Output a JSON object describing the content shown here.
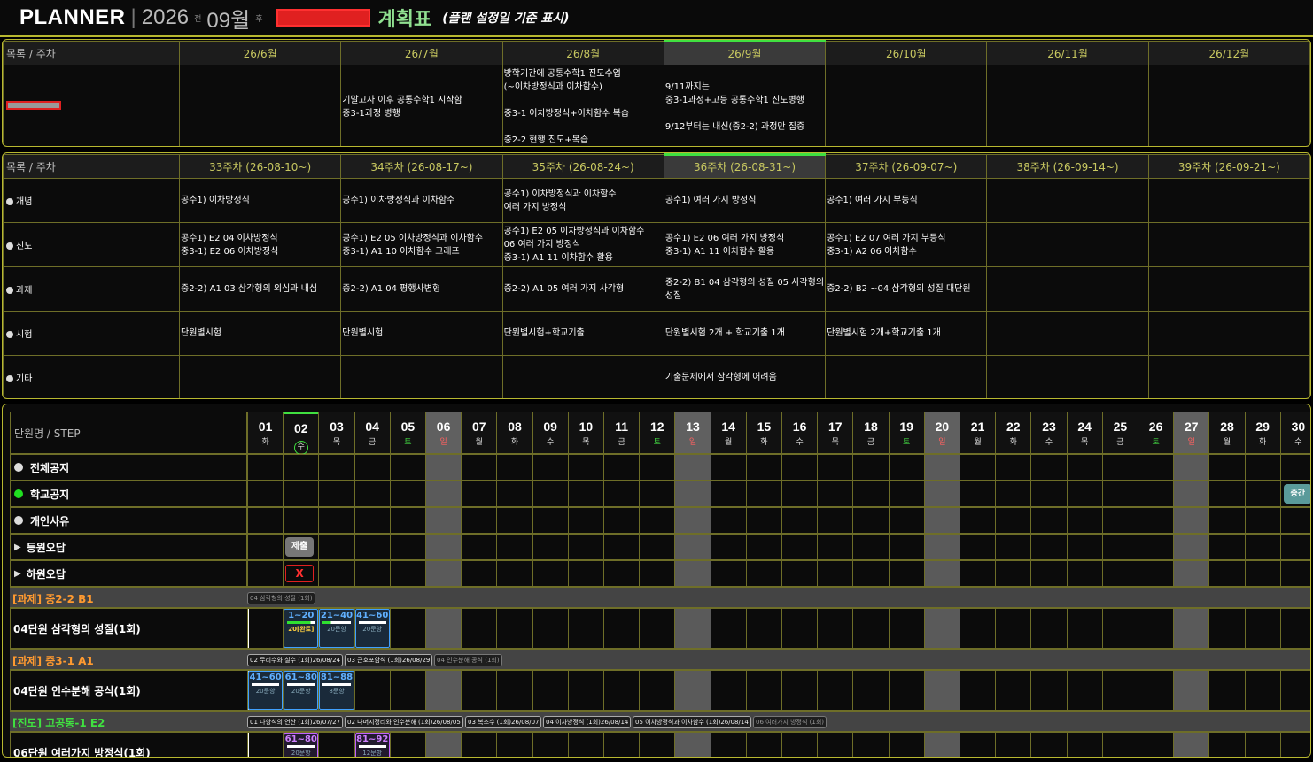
{
  "header": {
    "planner": "PLANNER",
    "sep": "|",
    "year": "2026",
    "prev_small": "전",
    "month": "09월",
    "next_small": "후",
    "title": "계획표",
    "note": "(플랜 설정일 기준 표시)"
  },
  "monthly": {
    "corner": "목록 / 주차",
    "columns": [
      "26/6월",
      "26/7월",
      "26/8월",
      "26/9월",
      "26/10월",
      "26/11월",
      "26/12월"
    ],
    "current_index": 3,
    "cells": [
      "",
      "기말고사 이후 공통수학1 시작함\n중3-1과정 병행",
      "방학기간에 공통수학1 진도수업\n(~이차방정식과 이차함수)\n\n중3-1 이차방정식+이차함수 복습\n\n중2-2 현행 진도+복습",
      "9/11까지는\n   중3-1과정+고등 공통수학1 진도병행\n\n9/12부터는 내신(중2-2) 과정만 집중",
      "",
      "",
      ""
    ]
  },
  "weekly": {
    "corner": "목록 / 주차",
    "columns": [
      "33주차 (26-08-10~)",
      "34주차 (26-08-17~)",
      "35주차 (26-08-24~)",
      "36주차 (26-08-31~)",
      "37주차 (26-09-07~)",
      "38주차 (26-09-14~)",
      "39주차 (26-09-21~)"
    ],
    "current_index": 3,
    "rows": [
      {
        "label": "개념",
        "cells": [
          "공수1) 이차방정식",
          "공수1) 이차방정식과 이차함수",
          "공수1) 이차방정식과 이차함수\n여러 가지 방정식",
          "공수1) 여러 가지 방정식",
          "공수1) 여러 가지 부등식",
          "",
          ""
        ]
      },
      {
        "label": "진도",
        "cells": [
          "공수1) E2 04 이차방정식\n중3-1) E2 06 이차방정식",
          "공수1) E2 05 이차방정식과 이차함수\n중3-1) A1 10 이차함수 그래프",
          "공수1) E2 05 이차방정식과 이차함수\n06 여러 가지 방정식\n중3-1) A1 11 이차함수 활용",
          "공수1) E2 06 여러 가지 방정식\n중3-1) A1 11 이차함수 활용",
          "공수1) E2 07 여러 가지 부등식\n중3-1) A2 06 이차함수",
          "",
          ""
        ]
      },
      {
        "label": "과제",
        "cells": [
          "중2-2) A1 03 삼각형의 외심과 내심",
          "중2-2) A1 04 평행사변형",
          "중2-2) A1 05 여러 가지 사각형",
          "중2-2) B1 04 삼각형의 성질 05 사각형의 성질",
          "중2-2) B2 ~04 삼각형의 성질 대단원",
          "",
          ""
        ]
      },
      {
        "label": "시험",
        "cells": [
          "단원별시험",
          "단원별시험",
          "단원별시험+학교기출",
          "단원별시험 2개 + 학교기출 1개",
          "단원별시험 2개+학교기출 1개",
          "",
          ""
        ]
      },
      {
        "label": "기타",
        "cells": [
          "",
          "",
          "",
          "기출문제에서 삼각형에 어려움",
          "",
          "",
          ""
        ]
      }
    ]
  },
  "calendar": {
    "corner": "단원명 / STEP",
    "today_index": 1,
    "days": [
      {
        "d": "01",
        "w": "화"
      },
      {
        "d": "02",
        "w": "수"
      },
      {
        "d": "03",
        "w": "목"
      },
      {
        "d": "04",
        "w": "금"
      },
      {
        "d": "05",
        "w": "토"
      },
      {
        "d": "06",
        "w": "일"
      },
      {
        "d": "07",
        "w": "월"
      },
      {
        "d": "08",
        "w": "화"
      },
      {
        "d": "09",
        "w": "수"
      },
      {
        "d": "10",
        "w": "목"
      },
      {
        "d": "11",
        "w": "금"
      },
      {
        "d": "12",
        "w": "토"
      },
      {
        "d": "13",
        "w": "일"
      },
      {
        "d": "14",
        "w": "월"
      },
      {
        "d": "15",
        "w": "화"
      },
      {
        "d": "16",
        "w": "수"
      },
      {
        "d": "17",
        "w": "목"
      },
      {
        "d": "18",
        "w": "금"
      },
      {
        "d": "19",
        "w": "토"
      },
      {
        "d": "20",
        "w": "일"
      },
      {
        "d": "21",
        "w": "월"
      },
      {
        "d": "22",
        "w": "화"
      },
      {
        "d": "23",
        "w": "수"
      },
      {
        "d": "24",
        "w": "목"
      },
      {
        "d": "25",
        "w": "금"
      },
      {
        "d": "26",
        "w": "토"
      },
      {
        "d": "27",
        "w": "일"
      },
      {
        "d": "28",
        "w": "월"
      },
      {
        "d": "29",
        "w": "화"
      },
      {
        "d": "30",
        "w": "수"
      }
    ],
    "notice_rows": [
      {
        "label": "전체공지",
        "bullet": "#dddddd"
      },
      {
        "label": "학교공지",
        "bullet": "#20e020"
      },
      {
        "label": "개인사유",
        "bullet": "#dddddd"
      }
    ],
    "arrow_rows": [
      {
        "label": "등원오답",
        "arrow": "▶"
      },
      {
        "label": "하원오답",
        "arrow": "▶"
      }
    ],
    "submit_label": "제출",
    "x_label": "X",
    "school_event": "중간",
    "groups": [
      {
        "name": "[과제] 중2-2 B1",
        "color": "#ff9a30",
        "chips": [
          {
            "text": "04 삼각형의 성질 (1회)",
            "dim": true
          }
        ],
        "unit": "04단원 삼각형의 성질(1회)",
        "progress": [
          {
            "day": 1,
            "range": "1~20",
            "qty": "20[완료]",
            "color": "#40a0ff",
            "fill": 0.85
          },
          {
            "day": 2,
            "range": "21~40",
            "qty": "20문항",
            "color": "#40a0ff",
            "fill": 0.3
          },
          {
            "day": 3,
            "range": "41~60",
            "qty": "20문항",
            "color": "#40a0ff",
            "fill": 0
          }
        ]
      },
      {
        "name": "[과제] 중3-1 A1",
        "color": "#ff9a30",
        "chips": [
          {
            "text": "02 무리수와 실수 (1회)26/08/24",
            "dim": false
          },
          {
            "text": "03 근호포함식 (1회)26/08/29",
            "dim": false
          },
          {
            "text": "04 인수분해 공식 (1회)",
            "dim": true
          }
        ],
        "unit": "04단원 인수분해 공식(1회)",
        "progress": [
          {
            "day": 0,
            "range": "41~60",
            "qty": "20문항",
            "color": "#40a0ff",
            "fill": 0
          },
          {
            "day": 1,
            "range": "61~80",
            "qty": "20문항",
            "color": "#40a0ff",
            "fill": 0
          },
          {
            "day": 2,
            "range": "81~88",
            "qty": "8문항",
            "color": "#40a0ff",
            "fill": 0
          }
        ]
      },
      {
        "name": "[진도] 고공통-1 E2",
        "color": "#40e040",
        "chips": [
          {
            "text": "01 다항식의 연산 (1회)26/07/27",
            "dim": false
          },
          {
            "text": "02 나머지정리와 인수분해 (1회)26/08/05",
            "dim": false
          },
          {
            "text": "03 복소수 (1회)26/08/07",
            "dim": false
          },
          {
            "text": "04 이차방정식 (1회)26/08/14",
            "dim": false
          },
          {
            "text": "05 이차방정식과 이차함수 (1회)26/08/14",
            "dim": false
          },
          {
            "text": "06 여러가지 방정식 (1회)",
            "dim": true
          }
        ],
        "unit": "06단원 여러가지 방정식(1회)",
        "progress": [
          {
            "day": 1,
            "range": "61~80",
            "qty": "20문항",
            "color": "#c060ff",
            "fill": 0
          },
          {
            "day": 3,
            "range": "81~92",
            "qty": "12문항",
            "color": "#c060ff",
            "fill": 0
          }
        ]
      }
    ]
  }
}
